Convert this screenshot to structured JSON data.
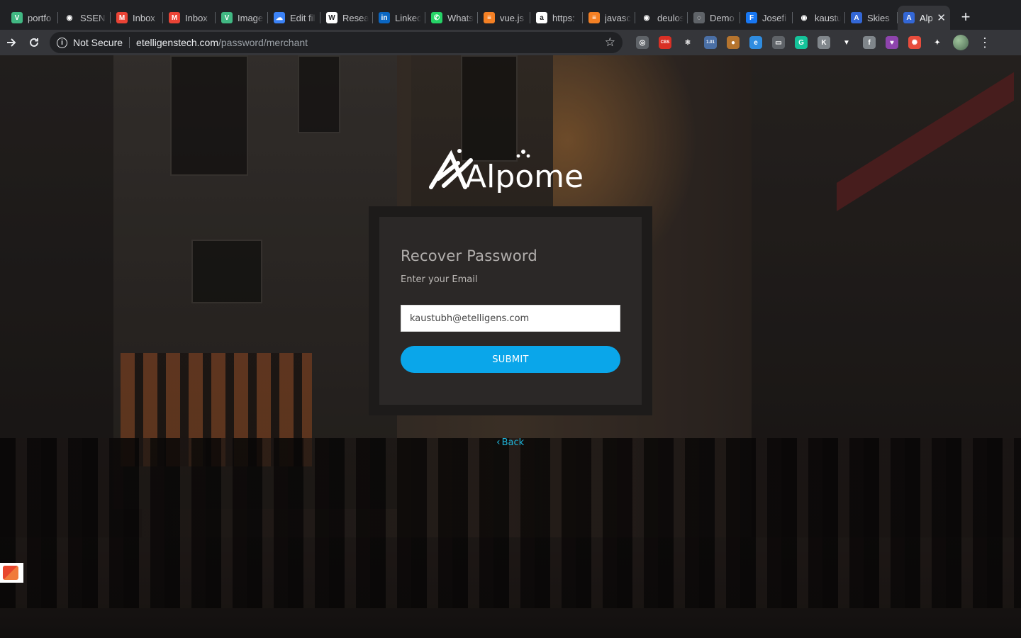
{
  "browser": {
    "tabs": [
      {
        "title": "portfo",
        "icon": "vue-icon",
        "color": "#41b883",
        "glyph": "V"
      },
      {
        "title": "SSENS",
        "icon": "github-icon",
        "color": "#202124",
        "glyph": "◉"
      },
      {
        "title": "Inbox",
        "icon": "gmail-icon",
        "color": "#ea4335",
        "glyph": "M"
      },
      {
        "title": "Inbox",
        "icon": "gmail-icon",
        "color": "#ea4335",
        "glyph": "M"
      },
      {
        "title": "Image",
        "icon": "vue-icon",
        "color": "#41b883",
        "glyph": "V"
      },
      {
        "title": "Edit fil",
        "icon": "cloud-icon",
        "color": "#3b82f6",
        "glyph": "☁"
      },
      {
        "title": "Resea",
        "icon": "wikipedia-icon",
        "color": "#ffffff",
        "glyph": "W"
      },
      {
        "title": "Linked",
        "icon": "linkedin-icon",
        "color": "#0a66c2",
        "glyph": "in"
      },
      {
        "title": "Whats",
        "icon": "whatsapp-icon",
        "color": "#25d366",
        "glyph": "✆"
      },
      {
        "title": "vue.js",
        "icon": "stackoverflow-icon",
        "color": "#f48024",
        "glyph": "≡"
      },
      {
        "title": "https:",
        "icon": "amazon-icon",
        "color": "#ffffff",
        "glyph": "a"
      },
      {
        "title": "javasc",
        "icon": "stackoverflow-icon",
        "color": "#f48024",
        "glyph": "≡"
      },
      {
        "title": "deulos",
        "icon": "github-icon",
        "color": "#202124",
        "glyph": "◉"
      },
      {
        "title": "Demo",
        "icon": "globe-icon",
        "color": "#5f6368",
        "glyph": "◌"
      },
      {
        "title": "Josefi",
        "icon": "facebook-icon",
        "color": "#1877f2",
        "glyph": "F"
      },
      {
        "title": "kaustu",
        "icon": "github-icon",
        "color": "#202124",
        "glyph": "◉"
      },
      {
        "title": "Skies",
        "icon": "alpome-icon",
        "color": "#3367d6",
        "glyph": "A"
      }
    ],
    "active_tab": {
      "title": "Alp",
      "icon": "alpome-icon",
      "color": "#3367d6",
      "glyph": "A"
    },
    "new_tab_label": "+",
    "security_label": "Not Secure",
    "url_host": "etelligenstech.com",
    "url_path": "/password/merchant",
    "extensions": [
      {
        "name": "target-icon",
        "color": "#5f6368",
        "glyph": "◎"
      },
      {
        "name": "cbs-icon",
        "color": "#d93025",
        "glyph": "CBS"
      },
      {
        "name": "react-icon",
        "color": "#35363a",
        "glyph": "⚛"
      },
      {
        "name": "badge-icon",
        "color": "#4a6fa5",
        "glyph": "1.01"
      },
      {
        "name": "cookie-icon",
        "color": "#b5742e",
        "glyph": "●"
      },
      {
        "name": "edge-icon",
        "color": "#2f8ce0",
        "glyph": "e"
      },
      {
        "name": "screen-icon",
        "color": "#5f6368",
        "glyph": "▭"
      },
      {
        "name": "grammarly-icon",
        "color": "#15c39a",
        "glyph": "G"
      },
      {
        "name": "k-icon",
        "color": "#80868b",
        "glyph": "K"
      },
      {
        "name": "vuetools-icon",
        "color": "#35363a",
        "glyph": "▼"
      },
      {
        "name": "facebook-ext-icon",
        "color": "#80868b",
        "glyph": "f"
      },
      {
        "name": "shield-ext-icon",
        "color": "#8e44ad",
        "glyph": "♥"
      },
      {
        "name": "color-icon",
        "color": "#e74c3c",
        "glyph": "✺"
      },
      {
        "name": "puzzle-icon",
        "color": "#35363a",
        "glyph": "✦"
      }
    ]
  },
  "page": {
    "brand": "Alpome",
    "title": "Recover Password",
    "subtitle": "Enter your Email",
    "email_value": "kaustubh@etelligens.com",
    "submit_label": "SUBMIT",
    "back_label": "Back",
    "accent_color": "#0aa6ea",
    "link_color": "#1fb3d8"
  }
}
